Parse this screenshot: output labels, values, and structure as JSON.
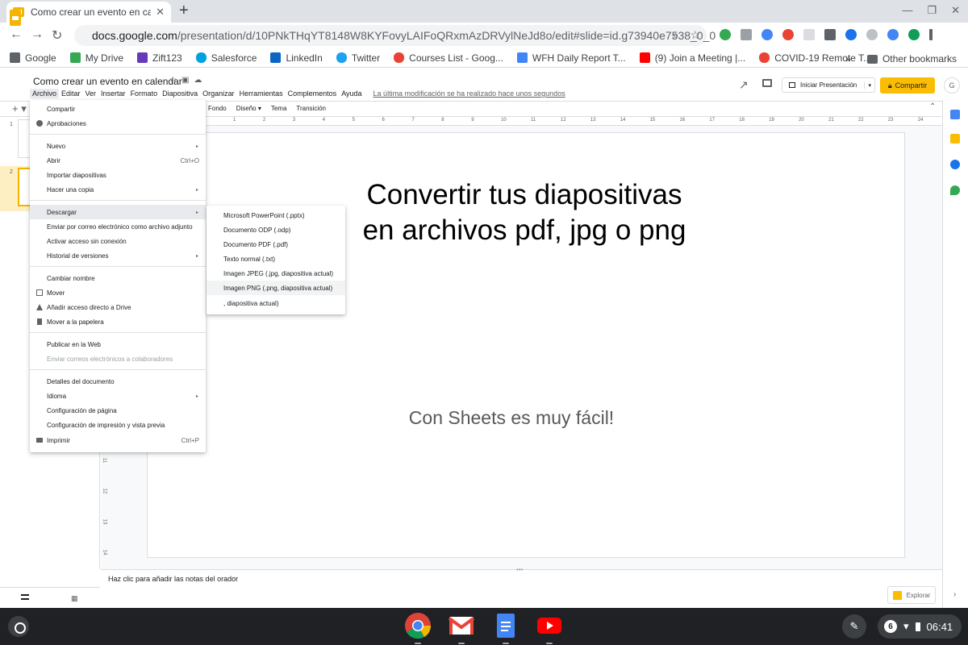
{
  "browser": {
    "tab_title": "Como crear un evento en calend",
    "url_host": "docs.google.com",
    "url_path": "/presentation/d/10PNkTHqYT8148W8KYFovyLAIFoQRxmAzDRVylNeJd8o/edit#slide=id.g73940e7538_0_0"
  },
  "bookmarks": {
    "items": [
      {
        "label": "Google",
        "color": "#5f6368"
      },
      {
        "label": "My Drive",
        "color": "#34a853"
      },
      {
        "label": "Zift123",
        "color": "#673ab7"
      },
      {
        "label": "Salesforce",
        "color": "#00a1e0"
      },
      {
        "label": "LinkedIn",
        "color": "#0a66c2"
      },
      {
        "label": "Twitter",
        "color": "#1da1f2"
      },
      {
        "label": "Courses List - Goog...",
        "color": "#ea4335"
      },
      {
        "label": "WFH Daily Report T...",
        "color": "#4285f4"
      },
      {
        "label": "(9) Join a Meeting |...",
        "color": "#ff0000"
      },
      {
        "label": "COVID-19 Remote T...",
        "color": "#ea4335"
      }
    ],
    "more": "»",
    "other": "Other bookmarks"
  },
  "slides": {
    "doc_title": "Como crear un evento en calendar",
    "menus": [
      "Archivo",
      "Editar",
      "Ver",
      "Insertar",
      "Formato",
      "Diapositiva",
      "Organizar",
      "Herramientas",
      "Complementos",
      "Ayuda"
    ],
    "last_edit": "La última modificación se ha realizado hace unos segundos",
    "present": "Iniciar Presentación",
    "share": "Compartir",
    "avatar": "G",
    "toolbar": {
      "fondo": "Fondo",
      "diseno": "Diseño ▾",
      "tema": "Tema",
      "transicion": "Transición"
    },
    "ruler": [
      "1",
      "2",
      "3",
      "4",
      "5",
      "6",
      "7",
      "8",
      "9",
      "10",
      "11",
      "12",
      "13",
      "14",
      "15",
      "16",
      "17",
      "18",
      "19",
      "20",
      "21",
      "22",
      "23",
      "24",
      "25"
    ],
    "vruler": [
      "11",
      "12",
      "13",
      "14"
    ],
    "slide_numbers": [
      "1",
      "2"
    ],
    "slide_title_line1": "Convertir tus diapositivas",
    "slide_title_line2": "en archivos pdf, jpg o png",
    "slide_subtitle": "Con Sheets es muy fácil!",
    "notes_placeholder": "Haz clic para añadir las notas del orador",
    "explore": "Explorar"
  },
  "file_menu": {
    "compartir": "Compartir",
    "aprobaciones": "Aprobaciones",
    "nuevo": "Nuevo",
    "abrir": "Abrir",
    "abrir_sc": "Ctrl+O",
    "importar": "Importar diapositivas",
    "copia": "Hacer una copia",
    "descargar": "Descargar",
    "enviar_adjunto": "Enviar por correo electrónico como archivo adjunto",
    "sin_conexion": "Activar acceso sin conexión",
    "historial": "Historial de versiones",
    "cambiar_nombre": "Cambiar nombre",
    "mover": "Mover",
    "acceso_drive": "Añadir acceso directo a Drive",
    "papelera": "Mover a la papelera",
    "publicar": "Publicar en la Web",
    "enviar_colab": "Enviar correos electrónicos a colaboradores",
    "detalles": "Detalles del documento",
    "idioma": "Idioma",
    "config_pagina": "Configuración de página",
    "config_impresion": "Configuración de impresión y vista previa",
    "imprimir": "Imprimir",
    "imprimir_sc": "Ctrl+P"
  },
  "download_menu": {
    "pptx": "Microsoft PowerPoint (.pptx)",
    "odp": "Documento ODP (.odp)",
    "pdf": "Documento PDF (.pdf)",
    "txt": "Texto normal (.txt)",
    "jpg": "Imagen JPEG (.jpg, diapositiva actual)",
    "png": "Imagen PNG (.png, diapositiva actual)",
    "svg": ", diapositiva actual)"
  },
  "shelf": {
    "notifications": "6",
    "time": "06:41"
  }
}
